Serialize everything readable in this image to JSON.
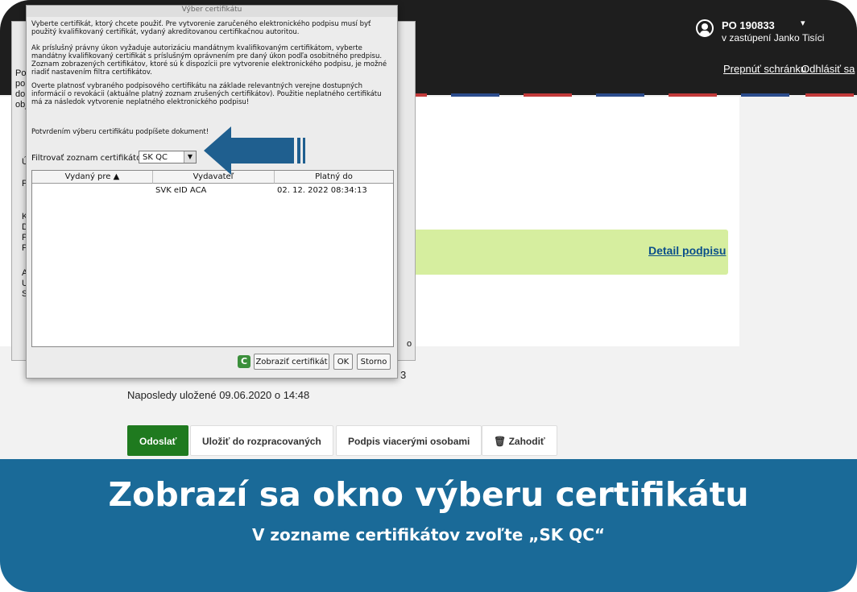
{
  "header": {
    "user_name": "PO 190833",
    "user_caret": "▾",
    "user_sub": "v zastúpení Janko Tisíci",
    "switch_mailbox": "Prepnúť schránku",
    "logout": "Odhlásiť sa"
  },
  "content": {
    "detail_link": "Detail podpisu",
    "saved_text": "Naposledy uložené 09.06.2020 o 14:48",
    "obscured_fragment": "3"
  },
  "actions": {
    "send": "Odoslať",
    "save_draft": "Uložiť do rozpracovaných",
    "multi_sign": "Podpis viacerými osobami",
    "discard": "Zahodiť"
  },
  "dialog": {
    "title": "Výber certifikátu",
    "para1": "Vyberte certifikát, ktorý chcete použiť. Pre vytvorenie zaručeného elektronického podpisu musí byť použitý kvalifikovaný certifikát, vydaný akreditovanou certifikačnou autoritou.",
    "para2": "Ak príslušný právny úkon vyžaduje autorizáciu mandátnym kvalifikovaným certifikátom, vyberte mandátny kvalifikovaný certifikát s príslušným oprávnením pre daný úkon podľa osobitného predpisu. Zoznam zobrazených certifikátov, ktoré sú k dispozícii pre vytvorenie elektronického podpisu, je možné riadiť nastavením filtra certifikátov.",
    "para3": "Overte platnosť vybraného podpisového certifikátu na základe relevantných verejne dostupných informácií o revokácii (aktuálne platný zoznam zrušených certifikátov). Použitie neplatného certifikátu má za následok vytvorenie neplatného elektronického podpisu!",
    "para4": "Potvrdením výberu certifikátu podpíšete dokument!",
    "filter_label": "Filtrovať zoznam certifikátov:",
    "filter_value": "SK QC",
    "columns": [
      "Vydaný pre ▲",
      "Vydavateľ",
      "Platný do"
    ],
    "rows": [
      {
        "issued_to": "",
        "issuer": "SVK eID ACA",
        "valid_to": "02. 12. 2022 08:34:13"
      }
    ],
    "btn_show_cert": "Zobraziť certifikát",
    "btn_ok": "OK",
    "btn_cancel": "Storno"
  },
  "background_dialog": {
    "side_fragments": [
      "Po",
      "po",
      "do",
      "obj",
      "Ú",
      "P",
      "K",
      "D",
      "P",
      "P",
      "A",
      "U",
      "S"
    ],
    "right_fragment": "o"
  },
  "banner": {
    "title": "Zobrazí sa okno výberu certifikátu",
    "subtitle": "V zozname certifikátov zvoľte „SK QC“"
  },
  "colors": {
    "header_bg": "#1e1e1e",
    "banner_bg": "#1a6a98",
    "send_button": "#1f7a1f",
    "success_box": "#d6ee9f",
    "arrow": "#1f5f8f"
  }
}
